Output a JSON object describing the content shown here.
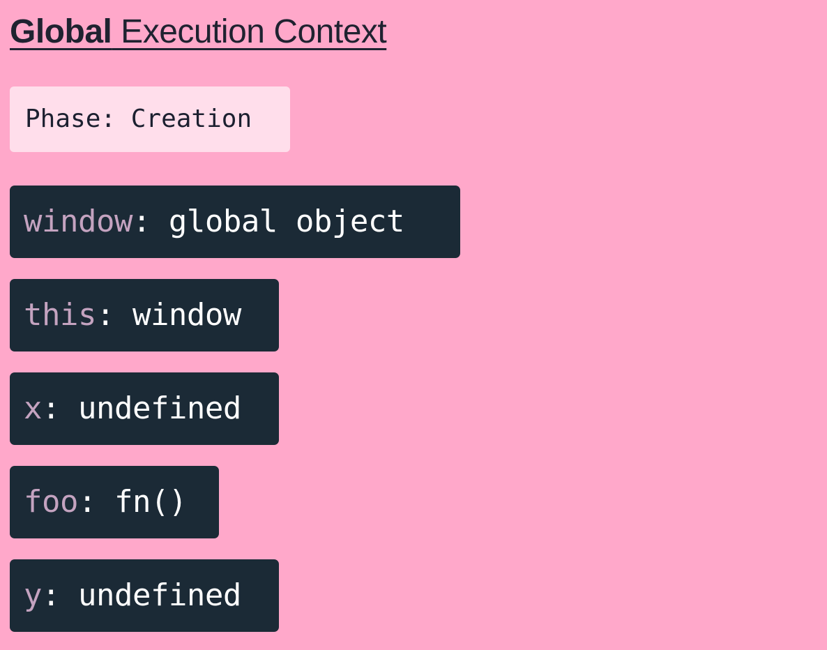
{
  "title": {
    "bold": "Global",
    "rest": " Execution Context"
  },
  "phase": {
    "label": "Phase:",
    "value": "Creation"
  },
  "bindings": [
    {
      "key": "window",
      "value": ": global object"
    },
    {
      "key": "this",
      "value": ": window"
    },
    {
      "key": "x",
      "value": ": undefined"
    },
    {
      "key": "foo",
      "value": ": fn()"
    },
    {
      "key": "y",
      "value": ": undefined"
    }
  ],
  "colors": {
    "background": "#FFA8CA",
    "phase_badge": "#FFDEEB",
    "binding_box": "#1B2A36",
    "binding_key": "#C4A3C0",
    "binding_value": "#FFFFFF"
  }
}
